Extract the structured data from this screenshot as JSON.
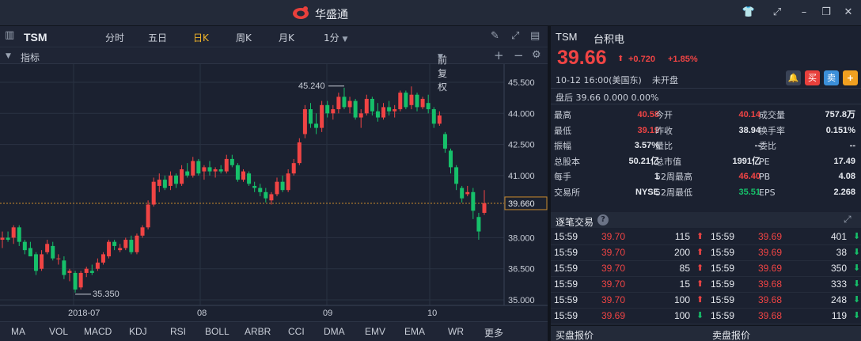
{
  "app": {
    "title": "华盛通"
  },
  "toolbar": {
    "symbol": "TSM",
    "tabs": [
      "分时",
      "五日",
      "日K",
      "周K",
      "月K",
      "1分"
    ],
    "active_tab": "日K"
  },
  "indicator_bar": {
    "label": "指标",
    "adjust": "前复权"
  },
  "chart_data": {
    "type": "candlestick",
    "y_ticks": [
      "45.500",
      "44.000",
      "42.500",
      "41.000",
      "39.660",
      "38.000",
      "36.500",
      "35.000"
    ],
    "x_labels": [
      "2018-07",
      "08",
      "09",
      "10"
    ],
    "current_price_line": 39.66,
    "annotation_high": "45.240",
    "annotation_low": "35.350",
    "ylim": [
      35,
      46
    ],
    "candles": [
      {
        "o": 37.9,
        "h": 38.3,
        "l": 37.5,
        "c": 38.0
      },
      {
        "o": 38.0,
        "h": 38.3,
        "l": 37.8,
        "c": 37.9
      },
      {
        "o": 38.0,
        "h": 38.6,
        "l": 37.7,
        "c": 38.5
      },
      {
        "o": 38.5,
        "h": 38.6,
        "l": 37.6,
        "c": 37.8
      },
      {
        "o": 37.8,
        "h": 37.9,
        "l": 37.2,
        "c": 37.4
      },
      {
        "o": 37.5,
        "h": 37.8,
        "l": 37.1,
        "c": 37.1
      },
      {
        "o": 37.2,
        "h": 37.3,
        "l": 36.2,
        "c": 36.4
      },
      {
        "o": 36.5,
        "h": 37.4,
        "l": 36.4,
        "c": 37.2
      },
      {
        "o": 37.3,
        "h": 37.9,
        "l": 37.2,
        "c": 37.7
      },
      {
        "o": 37.6,
        "h": 37.8,
        "l": 36.9,
        "c": 37.0
      },
      {
        "o": 37.0,
        "h": 37.2,
        "l": 36.7,
        "c": 37.0
      },
      {
        "o": 36.9,
        "h": 37.1,
        "l": 36.0,
        "c": 36.2
      },
      {
        "o": 36.3,
        "h": 36.5,
        "l": 35.9,
        "c": 36.4
      },
      {
        "o": 36.3,
        "h": 36.4,
        "l": 35.35,
        "c": 35.5
      },
      {
        "o": 35.6,
        "h": 36.4,
        "l": 35.5,
        "c": 36.3
      },
      {
        "o": 36.3,
        "h": 36.6,
        "l": 36.1,
        "c": 36.5
      },
      {
        "o": 36.4,
        "h": 36.7,
        "l": 36.2,
        "c": 36.3
      },
      {
        "o": 36.5,
        "h": 37.0,
        "l": 36.4,
        "c": 36.8
      },
      {
        "o": 36.8,
        "h": 37.3,
        "l": 36.7,
        "c": 37.2
      },
      {
        "o": 37.1,
        "h": 37.9,
        "l": 37.0,
        "c": 37.8
      },
      {
        "o": 37.8,
        "h": 37.9,
        "l": 37.4,
        "c": 37.6
      },
      {
        "o": 37.4,
        "h": 37.7,
        "l": 37.3,
        "c": 37.5
      },
      {
        "o": 37.5,
        "h": 38.0,
        "l": 37.4,
        "c": 37.9
      },
      {
        "o": 37.9,
        "h": 38.1,
        "l": 37.2,
        "c": 37.3
      },
      {
        "o": 37.3,
        "h": 38.2,
        "l": 37.2,
        "c": 38.1
      },
      {
        "o": 38.1,
        "h": 38.6,
        "l": 38.0,
        "c": 38.5
      },
      {
        "o": 38.5,
        "h": 39.8,
        "l": 38.4,
        "c": 39.6
      },
      {
        "o": 39.6,
        "h": 40.9,
        "l": 39.5,
        "c": 40.7
      },
      {
        "o": 40.5,
        "h": 41.1,
        "l": 40.2,
        "c": 40.8
      },
      {
        "o": 40.8,
        "h": 41.0,
        "l": 40.3,
        "c": 40.4
      },
      {
        "o": 40.5,
        "h": 41.2,
        "l": 40.3,
        "c": 41.0
      },
      {
        "o": 41.0,
        "h": 41.1,
        "l": 40.4,
        "c": 40.6
      },
      {
        "o": 40.6,
        "h": 41.5,
        "l": 40.5,
        "c": 41.3
      },
      {
        "o": 41.2,
        "h": 41.6,
        "l": 40.9,
        "c": 41.0
      },
      {
        "o": 41.0,
        "h": 41.9,
        "l": 40.9,
        "c": 41.7
      },
      {
        "o": 41.7,
        "h": 41.8,
        "l": 41.0,
        "c": 41.1
      },
      {
        "o": 41.2,
        "h": 41.5,
        "l": 40.8,
        "c": 41.4
      },
      {
        "o": 41.4,
        "h": 41.7,
        "l": 41.0,
        "c": 41.2
      },
      {
        "o": 41.2,
        "h": 41.4,
        "l": 40.9,
        "c": 41.3
      },
      {
        "o": 41.3,
        "h": 41.5,
        "l": 41.1,
        "c": 41.2
      },
      {
        "o": 41.2,
        "h": 42.0,
        "l": 41.1,
        "c": 41.8
      },
      {
        "o": 41.8,
        "h": 42.0,
        "l": 41.4,
        "c": 41.5
      },
      {
        "o": 41.5,
        "h": 41.6,
        "l": 40.7,
        "c": 40.8
      },
      {
        "o": 40.8,
        "h": 41.3,
        "l": 40.7,
        "c": 41.2
      },
      {
        "o": 41.1,
        "h": 41.2,
        "l": 40.5,
        "c": 40.6
      },
      {
        "o": 40.5,
        "h": 40.7,
        "l": 40.2,
        "c": 40.4
      },
      {
        "o": 40.4,
        "h": 40.6,
        "l": 40.0,
        "c": 40.2
      },
      {
        "o": 40.2,
        "h": 40.4,
        "l": 39.7,
        "c": 39.9
      },
      {
        "o": 39.8,
        "h": 40.2,
        "l": 39.6,
        "c": 40.1
      },
      {
        "o": 40.1,
        "h": 40.9,
        "l": 40.0,
        "c": 40.7
      },
      {
        "o": 40.7,
        "h": 41.0,
        "l": 40.2,
        "c": 40.3
      },
      {
        "o": 40.3,
        "h": 41.3,
        "l": 40.2,
        "c": 41.1
      },
      {
        "o": 41.1,
        "h": 41.8,
        "l": 41.0,
        "c": 41.6
      },
      {
        "o": 41.6,
        "h": 42.8,
        "l": 41.5,
        "c": 42.6
      },
      {
        "o": 43.0,
        "h": 44.4,
        "l": 42.8,
        "c": 44.2
      },
      {
        "o": 44.2,
        "h": 44.5,
        "l": 43.3,
        "c": 43.5
      },
      {
        "o": 43.5,
        "h": 44.0,
        "l": 43.0,
        "c": 43.3
      },
      {
        "o": 43.3,
        "h": 44.6,
        "l": 43.1,
        "c": 44.4
      },
      {
        "o": 44.4,
        "h": 44.6,
        "l": 43.8,
        "c": 44.0
      },
      {
        "o": 44.0,
        "h": 44.4,
        "l": 43.7,
        "c": 44.2
      },
      {
        "o": 44.2,
        "h": 45.0,
        "l": 44.0,
        "c": 44.8
      },
      {
        "o": 44.8,
        "h": 45.24,
        "l": 44.2,
        "c": 44.3
      },
      {
        "o": 44.3,
        "h": 44.8,
        "l": 44.0,
        "c": 44.6
      },
      {
        "o": 44.6,
        "h": 44.7,
        "l": 43.7,
        "c": 43.8
      },
      {
        "o": 43.8,
        "h": 44.2,
        "l": 43.3,
        "c": 44.0
      },
      {
        "o": 44.0,
        "h": 44.9,
        "l": 43.9,
        "c": 44.7
      },
      {
        "o": 44.7,
        "h": 44.8,
        "l": 43.9,
        "c": 44.1
      },
      {
        "o": 44.1,
        "h": 44.5,
        "l": 43.6,
        "c": 43.8
      },
      {
        "o": 43.8,
        "h": 44.5,
        "l": 43.7,
        "c": 44.3
      },
      {
        "o": 44.3,
        "h": 44.6,
        "l": 43.9,
        "c": 44.1
      },
      {
        "o": 44.1,
        "h": 44.4,
        "l": 43.8,
        "c": 44.2
      },
      {
        "o": 44.2,
        "h": 45.1,
        "l": 44.1,
        "c": 45.0
      },
      {
        "o": 45.0,
        "h": 45.1,
        "l": 44.2,
        "c": 44.3
      },
      {
        "o": 44.4,
        "h": 45.3,
        "l": 44.2,
        "c": 44.9
      },
      {
        "o": 44.9,
        "h": 45.0,
        "l": 44.1,
        "c": 44.3
      },
      {
        "o": 44.3,
        "h": 44.8,
        "l": 44.2,
        "c": 44.7
      },
      {
        "o": 44.5,
        "h": 44.9,
        "l": 44.0,
        "c": 44.2
      },
      {
        "o": 44.2,
        "h": 44.3,
        "l": 43.3,
        "c": 43.5
      },
      {
        "o": 43.5,
        "h": 44.1,
        "l": 43.4,
        "c": 43.9
      },
      {
        "o": 43.0,
        "h": 43.1,
        "l": 42.1,
        "c": 42.3
      },
      {
        "o": 42.2,
        "h": 42.3,
        "l": 41.1,
        "c": 41.4
      },
      {
        "o": 41.4,
        "h": 41.5,
        "l": 40.3,
        "c": 40.6
      },
      {
        "o": 40.4,
        "h": 40.5,
        "l": 39.7,
        "c": 39.9
      },
      {
        "o": 40.1,
        "h": 40.5,
        "l": 40.0,
        "c": 40.2
      },
      {
        "o": 40.2,
        "h": 40.4,
        "l": 38.9,
        "c": 39.3
      },
      {
        "o": 39.0,
        "h": 39.2,
        "l": 37.9,
        "c": 38.3
      },
      {
        "o": 39.2,
        "h": 40.3,
        "l": 39.1,
        "c": 39.66
      }
    ]
  },
  "indicators": [
    "MA",
    "VOL",
    "MACD",
    "KDJ",
    "RSI",
    "BOLL",
    "ARBR",
    "CCI",
    "DMA",
    "EMV",
    "EMA",
    "WR",
    "更多"
  ],
  "quote": {
    "code": "TSM",
    "name": "台积电",
    "price": "39.66",
    "change": "+0.720",
    "change_pct": "+1.85%",
    "time": "10-12 16:00(美国东)",
    "status": "未开盘",
    "after_hours": "盘后  39.66  0.000  0.00%",
    "buttons": [
      "买",
      "卖",
      "+"
    ]
  },
  "stats": [
    [
      {
        "label": "最高",
        "value": "40.58",
        "color": "red"
      },
      {
        "label": "今开",
        "value": "40.14",
        "color": "red"
      },
      {
        "label": "成交量",
        "value": "757.8万",
        "color": "white"
      }
    ],
    [
      {
        "label": "最低",
        "value": "39.19",
        "color": "red"
      },
      {
        "label": "昨收",
        "value": "38.94",
        "color": "white"
      },
      {
        "label": "换手率",
        "value": "0.151%",
        "color": "white"
      }
    ],
    [
      {
        "label": "振幅",
        "value": "3.57%",
        "color": "white"
      },
      {
        "label": "量比",
        "value": "--",
        "color": "white"
      },
      {
        "label": "委比",
        "value": "--",
        "color": "white"
      }
    ],
    [
      {
        "label": "总股本",
        "value": "50.21亿",
        "color": "white"
      },
      {
        "label": "总市值",
        "value": "1991亿",
        "color": "white"
      },
      {
        "label": "PE",
        "value": "17.49",
        "color": "white"
      }
    ],
    [
      {
        "label": "每手",
        "value": "1",
        "color": "white"
      },
      {
        "label": "52周最高",
        "value": "46.40",
        "color": "red"
      },
      {
        "label": "PB",
        "value": "4.08",
        "color": "white"
      }
    ],
    [
      {
        "label": "交易所",
        "value": "NYSE",
        "color": "white"
      },
      {
        "label": "52周最低",
        "value": "35.51",
        "color": "green"
      },
      {
        "label": "EPS",
        "value": "2.268",
        "color": "white"
      }
    ]
  ],
  "ticks": {
    "title": "逐笔交易",
    "rows": [
      [
        {
          "t": "15:59",
          "p": "39.70",
          "v": "115",
          "d": "up"
        },
        {
          "t": "15:59",
          "p": "39.69",
          "v": "401",
          "d": "down"
        }
      ],
      [
        {
          "t": "15:59",
          "p": "39.70",
          "v": "200",
          "d": "up"
        },
        {
          "t": "15:59",
          "p": "39.69",
          "v": "38",
          "d": "down"
        }
      ],
      [
        {
          "t": "15:59",
          "p": "39.70",
          "v": "85",
          "d": "up"
        },
        {
          "t": "15:59",
          "p": "39.69",
          "v": "350",
          "d": "down"
        }
      ],
      [
        {
          "t": "15:59",
          "p": "39.70",
          "v": "15",
          "d": "up"
        },
        {
          "t": "15:59",
          "p": "39.68",
          "v": "333",
          "d": "down"
        }
      ],
      [
        {
          "t": "15:59",
          "p": "39.70",
          "v": "100",
          "d": "up"
        },
        {
          "t": "15:59",
          "p": "39.68",
          "v": "248",
          "d": "down"
        }
      ],
      [
        {
          "t": "15:59",
          "p": "39.69",
          "v": "100",
          "d": "down"
        },
        {
          "t": "15:59",
          "p": "39.68",
          "v": "119",
          "d": "down"
        }
      ]
    ]
  },
  "book": {
    "bid_title": "买盘报价",
    "ask_title": "卖盘报价"
  },
  "colors": {
    "up": "#f04444",
    "down": "#16c06a",
    "accent": "#f0b429",
    "bg": "#1b2130"
  }
}
